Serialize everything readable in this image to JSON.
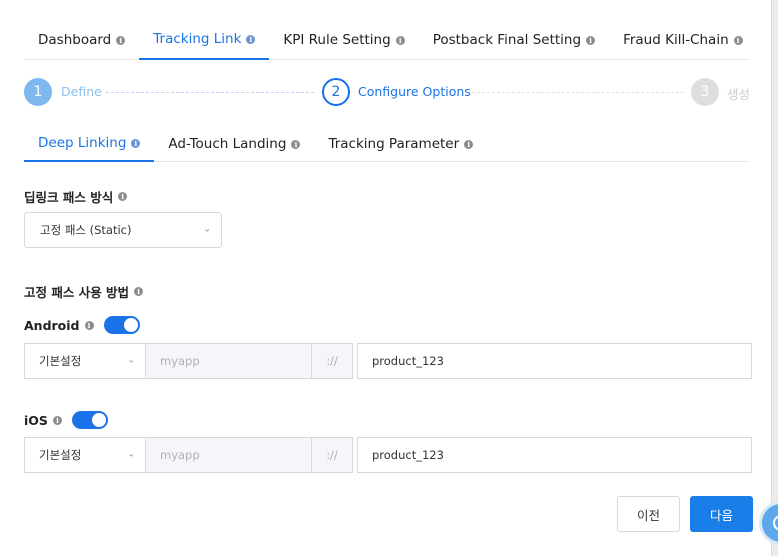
{
  "top_tabs": [
    {
      "label": "Dashboard"
    },
    {
      "label": "Tracking Link"
    },
    {
      "label": "KPI Rule Setting"
    },
    {
      "label": "Postback Final Setting"
    },
    {
      "label": "Fraud Kill-Chain"
    }
  ],
  "stepper": {
    "steps": [
      {
        "number": "1",
        "label": "Define"
      },
      {
        "number": "2",
        "label": "Configure Options"
      },
      {
        "number": "3",
        "label": "생성"
      }
    ]
  },
  "sub_tabs": [
    {
      "label": "Deep Linking"
    },
    {
      "label": "Ad-Touch Landing"
    },
    {
      "label": "Tracking Parameter"
    }
  ],
  "deeplink": {
    "path_type_title": "딥링크 패스 방식",
    "path_type_value": "고정 패스 (Static)",
    "usage_title": "고정 패스 사용 방법"
  },
  "android": {
    "label": "Android",
    "enabled": true,
    "mode_value": "기본설정",
    "scheme_placeholder": "myapp",
    "separator": "://",
    "path_value": "product_123"
  },
  "ios": {
    "label": "iOS",
    "enabled": true,
    "mode_value": "기본설정",
    "scheme_placeholder": "myapp",
    "separator": "://",
    "path_value": "product_123"
  },
  "footer": {
    "prev_label": "이전",
    "next_label": "다음"
  },
  "colors": {
    "accent": "#1a73e8",
    "primary_button": "#1a7ee8"
  }
}
